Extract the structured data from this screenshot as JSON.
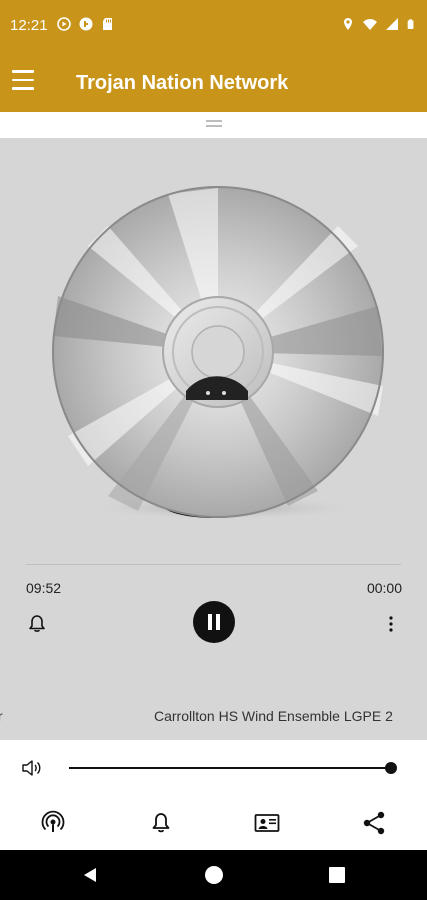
{
  "status_bar": {
    "time": "12:21",
    "left_icons": [
      "media-play-icon",
      "data-saver-icon",
      "sd-card-icon"
    ],
    "right_icons": [
      "location-icon",
      "wifi-icon",
      "signal-icon",
      "battery-icon"
    ]
  },
  "app_bar": {
    "title": "Trojan Nation Network",
    "menu_icon": "hamburger-menu-icon"
  },
  "colors": {
    "accent": "#c8951a",
    "player_bg": "#d6d6d6",
    "dark": "#111111"
  },
  "player": {
    "artwork": "compact-disc",
    "time_elapsed": "09:52",
    "time_total": "00:00",
    "marquee_left_fragment": "ır",
    "now_playing": "Carrollton HS Wind Ensemble LGPE 2",
    "controls": [
      "alarm-bell-icon",
      "pause-icon",
      "more-vert-icon"
    ]
  },
  "volume": {
    "icon": "volume-icon",
    "level_percent": 100
  },
  "bottom_nav": {
    "items": [
      "podcast-icon",
      "notification-bell-icon",
      "contact-card-icon",
      "share-icon"
    ]
  },
  "android_nav": {
    "items": [
      "back-icon",
      "home-icon",
      "recents-icon"
    ]
  }
}
